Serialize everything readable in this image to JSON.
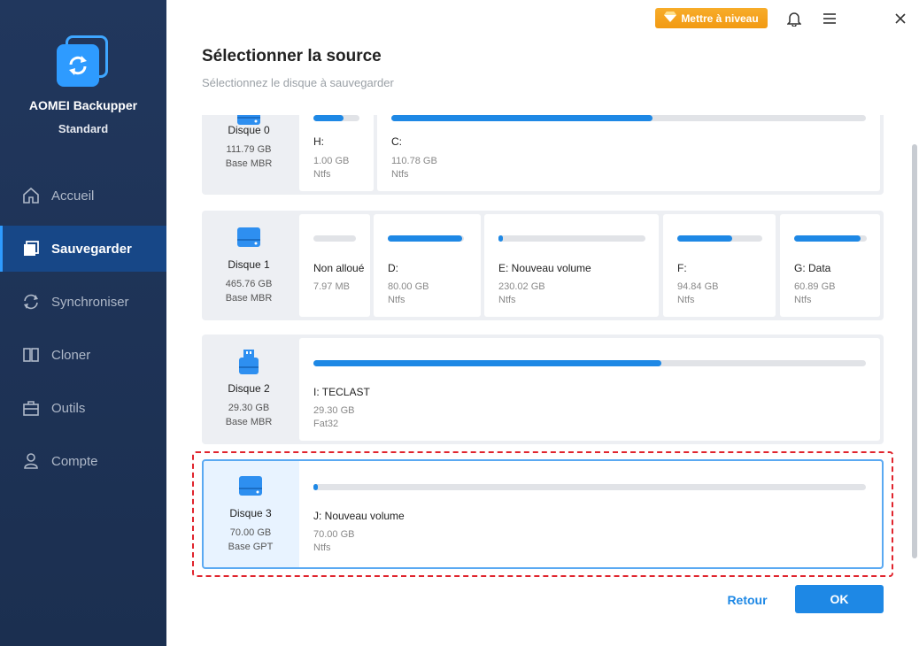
{
  "app": {
    "name": "AOMEI Backupper",
    "edition": "Standard"
  },
  "sidebar": {
    "items": [
      {
        "label": "Accueil",
        "icon": "home-icon",
        "active": false
      },
      {
        "label": "Sauvegarder",
        "icon": "backup-icon",
        "active": true
      },
      {
        "label": "Synchroniser",
        "icon": "sync-icon",
        "active": false
      },
      {
        "label": "Cloner",
        "icon": "clone-icon",
        "active": false
      },
      {
        "label": "Outils",
        "icon": "tools-icon",
        "active": false
      },
      {
        "label": "Compte",
        "icon": "account-icon",
        "active": false
      }
    ]
  },
  "topbar": {
    "upgrade_label": "Mettre à niveau",
    "icons": [
      "bell-icon",
      "menu-icon",
      "close-icon"
    ]
  },
  "header": {
    "title": "Sélectionner la source",
    "subtitle": "Sélectionnez le disque à sauvegarder"
  },
  "disks": [
    {
      "name": "Disque 0",
      "size": "111.79 GB",
      "type": "Base MBR",
      "icon": "hdd-icon",
      "selected": false,
      "partitions": [
        {
          "label": "H:",
          "size": "1.00 GB",
          "fs": "Ntfs",
          "used": 0.65
        },
        {
          "label": "C:",
          "size": "110.78 GB",
          "fs": "Ntfs",
          "used": 0.55
        }
      ]
    },
    {
      "name": "Disque 1",
      "size": "465.76 GB",
      "type": "Base MBR",
      "icon": "hdd-icon",
      "selected": false,
      "partitions": [
        {
          "label": "Non alloué",
          "size": "7.97 MB",
          "fs": "",
          "used": 0.0
        },
        {
          "label": "D:",
          "size": "80.00 GB",
          "fs": "Ntfs",
          "used": 0.98
        },
        {
          "label": "E: Nouveau volume",
          "size": "230.02 GB",
          "fs": "Ntfs",
          "used": 0.02
        },
        {
          "label": "F:",
          "size": "94.84 GB",
          "fs": "Ntfs",
          "used": 0.65
        },
        {
          "label": "G: Data",
          "size": "60.89 GB",
          "fs": "Ntfs",
          "used": 0.92
        }
      ]
    },
    {
      "name": "Disque 2",
      "size": "29.30 GB",
      "type": "Base MBR",
      "icon": "usb-drive-icon",
      "selected": false,
      "partitions": [
        {
          "label": "I: TECLAST",
          "size": "29.30 GB",
          "fs": "Fat32",
          "used": 0.63
        }
      ]
    },
    {
      "name": "Disque 3",
      "size": "70.00 GB",
      "type": "Base GPT",
      "icon": "hdd-icon",
      "selected": true,
      "partitions": [
        {
          "label": "J: Nouveau volume",
          "size": "70.00 GB",
          "fs": "Ntfs",
          "used": 0.01
        }
      ]
    }
  ],
  "footer": {
    "back_label": "Retour",
    "ok_label": "OK"
  },
  "colors": {
    "sidebar_bg": "#1d3557",
    "accent": "#1e88e5",
    "upgrade": "#f6a623",
    "highlight_frame": "#e0242d"
  }
}
